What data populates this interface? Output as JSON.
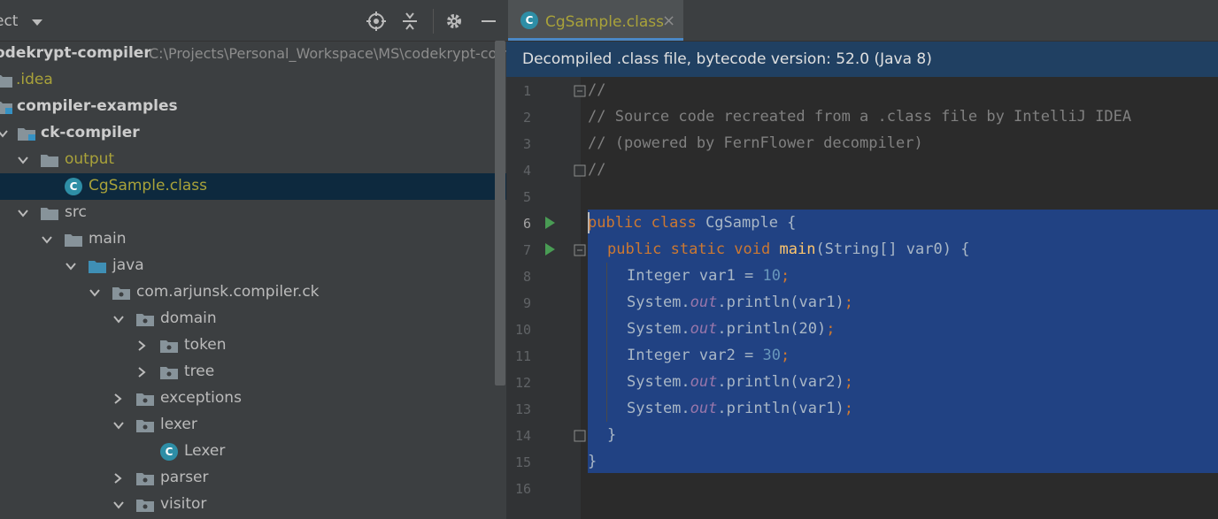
{
  "sidebar": {
    "title": "ect",
    "tree": [
      {
        "label": "odekrypt-compiler",
        "path": "C:\\Projects\\Personal_Workspace\\MS\\codekrypt-com",
        "style": "bold"
      },
      {
        "label": ".idea",
        "style": "yellow"
      },
      {
        "label": "compiler-examples",
        "style": "bold"
      },
      {
        "label": "ck-compiler",
        "style": "bold"
      },
      {
        "label": "output",
        "style": "yellow"
      },
      {
        "label": "CgSample.class",
        "style": "yellow"
      },
      {
        "label": "src"
      },
      {
        "label": "main"
      },
      {
        "label": "java"
      },
      {
        "label": "com.arjunsk.compiler.ck"
      },
      {
        "label": "domain"
      },
      {
        "label": "token"
      },
      {
        "label": "tree"
      },
      {
        "label": "exceptions"
      },
      {
        "label": "lexer"
      },
      {
        "label": "Lexer"
      },
      {
        "label": "parser"
      },
      {
        "label": "visitor"
      }
    ]
  },
  "editor": {
    "tab_label": "CgSample.class",
    "tab_close": "×",
    "banner": "Decompiled .class file, bytecode version: 52.0 (Java 8)",
    "line_numbers": [
      "1",
      "2",
      "3",
      "4",
      "5",
      "6",
      "7",
      "8",
      "9",
      "10",
      "11",
      "12",
      "13",
      "14",
      "15",
      "16"
    ],
    "code": {
      "l1": "//",
      "l2": "// Source code recreated from a .class file by IntelliJ IDEA",
      "l3": "// (powered by FernFlower decompiler)",
      "l4": "//",
      "l6_kw": "public class",
      "l6_rest": " CgSample {",
      "l7_kw": "public static void",
      "l7_fn": "main",
      "l7_rest": "(String[] var0) {",
      "l8_a": "Integer var1 = ",
      "l8_num": "10",
      "l9_arg": "(var1)",
      "l10_arg": "(20)",
      "l11_a": "Integer var2 = ",
      "l11_num": "30",
      "l12_arg": "(var2)",
      "l13_arg": "(var1)",
      "sys": "System.",
      "out": "out",
      "println": ".println",
      "semi": ";",
      "close_inner": "}",
      "close_outer": "}"
    }
  },
  "colors": {
    "sidebar_bg": "#3c3f41",
    "editor_bg": "#2b2b2b",
    "selection": "#214283",
    "banner": "#204062",
    "keyword": "#cc7832",
    "number": "#6897bb",
    "comment": "#808080",
    "static_field": "#9876aa"
  }
}
